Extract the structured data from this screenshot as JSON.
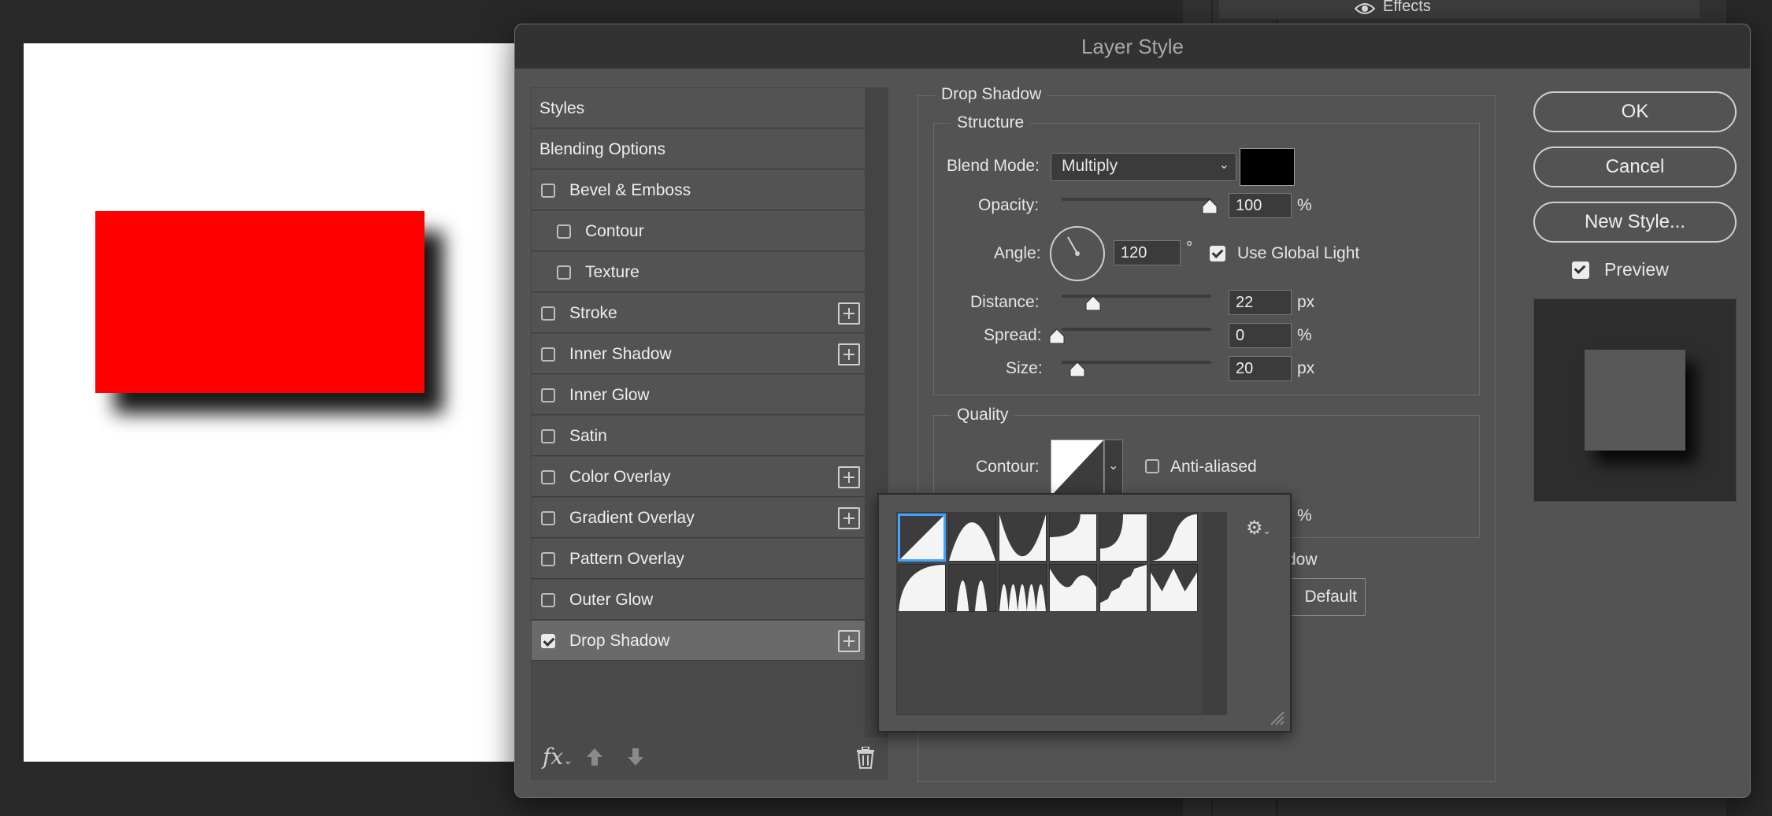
{
  "workspace": {
    "panel_row_label": "Effects"
  },
  "dialog": {
    "title": "Layer Style",
    "left_list": {
      "items": [
        {
          "label": "Styles",
          "checkbox": false,
          "indent": 0,
          "plus": false,
          "active": false
        },
        {
          "label": "Blending Options",
          "checkbox": false,
          "indent": 0,
          "plus": false,
          "active": false
        },
        {
          "label": "Bevel & Emboss",
          "checkbox": true,
          "checked": false,
          "indent": 1,
          "plus": false,
          "active": false
        },
        {
          "label": "Contour",
          "checkbox": true,
          "checked": false,
          "indent": 2,
          "plus": false,
          "active": false
        },
        {
          "label": "Texture",
          "checkbox": true,
          "checked": false,
          "indent": 2,
          "plus": false,
          "active": false
        },
        {
          "label": "Stroke",
          "checkbox": true,
          "checked": false,
          "indent": 1,
          "plus": true,
          "active": false
        },
        {
          "label": "Inner Shadow",
          "checkbox": true,
          "checked": false,
          "indent": 1,
          "plus": true,
          "active": false
        },
        {
          "label": "Inner Glow",
          "checkbox": true,
          "checked": false,
          "indent": 1,
          "plus": false,
          "active": false
        },
        {
          "label": "Satin",
          "checkbox": true,
          "checked": false,
          "indent": 1,
          "plus": false,
          "active": false
        },
        {
          "label": "Color Overlay",
          "checkbox": true,
          "checked": false,
          "indent": 1,
          "plus": true,
          "active": false
        },
        {
          "label": "Gradient Overlay",
          "checkbox": true,
          "checked": false,
          "indent": 1,
          "plus": true,
          "active": false
        },
        {
          "label": "Pattern Overlay",
          "checkbox": true,
          "checked": false,
          "indent": 1,
          "plus": false,
          "active": false
        },
        {
          "label": "Outer Glow",
          "checkbox": true,
          "checked": false,
          "indent": 1,
          "plus": false,
          "active": false
        },
        {
          "label": "Drop Shadow",
          "checkbox": true,
          "checked": true,
          "indent": 1,
          "plus": true,
          "active": true
        }
      ],
      "footer": {
        "fx_label": "fx"
      }
    },
    "drop_shadow": {
      "section_title": "Drop Shadow",
      "structure": {
        "title": "Structure",
        "blend_mode_label": "Blend Mode:",
        "blend_mode_value": "Multiply",
        "shadow_color": "#000000",
        "opacity_label": "Opacity:",
        "opacity_value": "100",
        "opacity_unit": "%",
        "opacity_fraction": 1.0,
        "angle_label": "Angle:",
        "angle_value": "120",
        "angle_unit": "°",
        "use_global_light_label": "Use Global Light",
        "use_global_light_checked": true,
        "distance_label": "Distance:",
        "distance_value": "22",
        "distance_unit": "px",
        "spread_label": "Spread:",
        "spread_value": "0",
        "spread_unit": "%",
        "size_label": "Size:",
        "size_value": "20",
        "size_unit": "px"
      },
      "quality": {
        "title": "Quality",
        "contour_label": "Contour:",
        "anti_aliased_label": "Anti-aliased",
        "anti_aliased_checked": false,
        "partial_percent": "%",
        "partial_knockout": "dow",
        "partial_default_button": "Default"
      }
    },
    "buttons": {
      "ok": "OK",
      "cancel": "Cancel",
      "new_style": "New Style...",
      "preview_label": "Preview",
      "preview_checked": true
    },
    "contour_picker": {
      "selected_index": 0,
      "gear_icon": "gear-icon",
      "presets": [
        "linear",
        "cone",
        "cone-inverted",
        "cove-deep",
        "cove-shallow",
        "gaussian",
        "half-round",
        "ring",
        "ring-double",
        "rolling-slope",
        "rounded-steps",
        "sawtooth"
      ]
    }
  },
  "colors": {
    "dialog_bg": "#535353",
    "canvas": "#ffffff",
    "layer_fill": "#ff0000",
    "selection_blue": "#3ea3ff"
  }
}
